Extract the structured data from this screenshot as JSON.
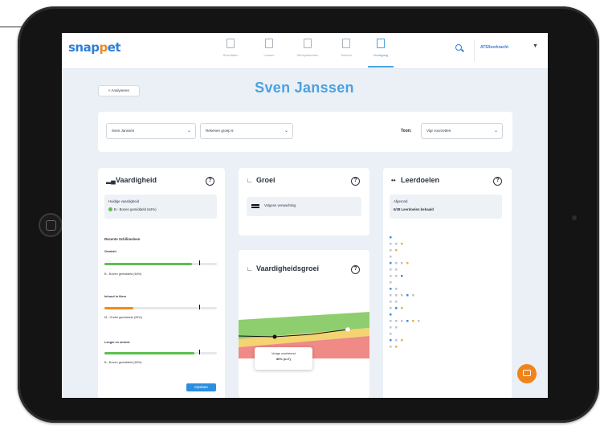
{
  "app": {
    "logo_part1": "snap",
    "logo_o": "p",
    "logo_part2": "et"
  },
  "nav": {
    "items": [
      {
        "label": "Resultaten",
        "icon": "home-icon"
      },
      {
        "label": "Lessen",
        "icon": "lessons-icon"
      },
      {
        "label": "Werkpakketten",
        "icon": "workpackage-icon"
      },
      {
        "label": "Toetsen",
        "icon": "tests-icon"
      },
      {
        "label": "Voortgang",
        "icon": "progress-icon",
        "active": true
      }
    ],
    "user_label": "ATS/leerkracht"
  },
  "page": {
    "back_label": "< Analyseren",
    "title": "Sven Janssen"
  },
  "filters": {
    "student": "Sven Janssen",
    "group": "Rekenen groep 6",
    "toon_label": "Toon:",
    "toon_value": "Vlgr voorzetten"
  },
  "vaardigheid": {
    "title": "Vaardigheid",
    "current_label": "Huidige vaardigheid",
    "current_value": "B - Boven gemiddeld (64%)",
    "section_label": "Recente Schilimeinen",
    "items": [
      {
        "name": "Gewicht",
        "status": "B - Boven gemiddeld (64%)",
        "fill": 0.78,
        "marker": 0.84,
        "color": "#5cbf4f"
      },
      {
        "name": "Inhoud in liters",
        "status": "M - Onder gemiddeld (26%)",
        "fill": 0.26,
        "marker": 0.84,
        "color": "#f08a1d"
      },
      {
        "name": "Lengte en omtrek",
        "status": "B - Boven gemiddeld (69%)",
        "fill": 0.8,
        "marker": 0.84,
        "color": "#5cbf4f"
      }
    ],
    "save_label": "Opslaan"
  },
  "groei": {
    "title": "Groei",
    "legend": "Volgens verwachting"
  },
  "vaardigheidsgroei": {
    "title": "Vaardigheidsgroei",
    "tooltip_line1": "Vorige overheerst",
    "tooltip_line2": "80% (n=7)"
  },
  "leerdoelen": {
    "title": "Leerdoelen",
    "summary_label": "Afgerond",
    "summary_value": "6/38 Leerdoelen behaald"
  },
  "colors": {
    "accent": "#4ba1df",
    "brand_orange": "#f08a1d",
    "good": "#5cbf4f"
  }
}
